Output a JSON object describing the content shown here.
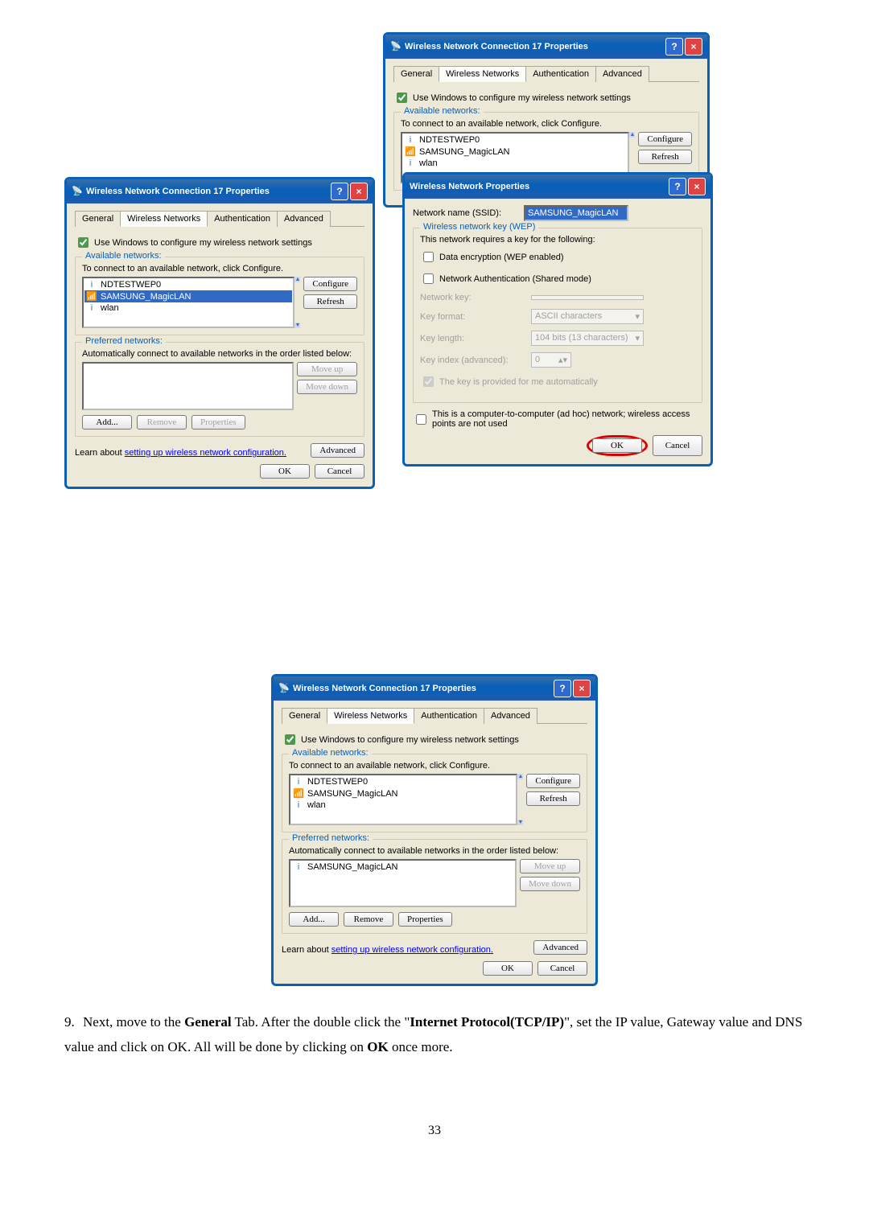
{
  "dialogs": {
    "left": {
      "title": "Wireless Network Connection 17 Properties",
      "tabs": [
        "General",
        "Wireless Networks",
        "Authentication",
        "Advanced"
      ],
      "use_windows": "Use Windows to configure my wireless network settings",
      "available_title": "Available networks:",
      "available_text": "To connect to an available network, click Configure.",
      "networks": [
        "NDTESTWEP0",
        "SAMSUNG_MagicLAN",
        "wlan"
      ],
      "configure": "Configure",
      "refresh": "Refresh",
      "preferred_title": "Preferred networks:",
      "preferred_text": "Automatically connect to available networks in the order listed below:",
      "move_up": "Move up",
      "move_down": "Move down",
      "add": "Add...",
      "remove": "Remove",
      "properties": "Properties",
      "learn_pre": "Learn about ",
      "learn_link": "setting up wireless network configuration.",
      "advanced": "Advanced",
      "ok": "OK",
      "cancel": "Cancel"
    },
    "right_top": {
      "title": "Wireless Network Connection 17 Properties",
      "tabs": [
        "General",
        "Wireless Networks",
        "Authentication",
        "Advanced"
      ],
      "use_windows": "Use Windows to configure my wireless network settings",
      "available_title": "Available networks:",
      "available_text": "To connect to an available network, click Configure.",
      "networks": [
        "NDTESTWEP0",
        "SAMSUNG_MagicLAN",
        "wlan"
      ],
      "configure": "Configure",
      "refresh": "Refresh"
    },
    "wnp": {
      "title": "Wireless Network Properties",
      "ssid_label": "Network name (SSID):",
      "ssid_value": "SAMSUNG_MagicLAN",
      "wep_title": "Wireless network key (WEP)",
      "wep_text": "This network requires a key for the following:",
      "data_enc": "Data encryption (WEP enabled)",
      "net_auth": "Network Authentication (Shared mode)",
      "net_key": "Network key:",
      "key_format": "Key format:",
      "key_format_val": "ASCII characters",
      "key_length": "Key length:",
      "key_length_val": "104 bits (13 characters)",
      "key_index": "Key index (advanced):",
      "key_index_val": "0",
      "key_auto": "The key is provided for me automatically",
      "adhoc": "This is a computer-to-computer (ad hoc) network; wireless access points are not used",
      "ok": "OK",
      "cancel": "Cancel"
    },
    "bottom": {
      "title": "Wireless Network Connection 17 Properties",
      "tabs": [
        "General",
        "Wireless Networks",
        "Authentication",
        "Advanced"
      ],
      "use_windows": "Use Windows to configure my wireless network settings",
      "available_title": "Available networks:",
      "available_text": "To connect to an available network, click Configure.",
      "networks": [
        "NDTESTWEP0",
        "SAMSUNG_MagicLAN",
        "wlan"
      ],
      "configure": "Configure",
      "refresh": "Refresh",
      "preferred_title": "Preferred networks:",
      "preferred_text": "Automatically connect to available networks in the order listed below:",
      "pref_item": "SAMSUNG_MagicLAN",
      "move_up": "Move up",
      "move_down": "Move down",
      "add": "Add...",
      "remove": "Remove",
      "properties": "Properties",
      "learn_pre": "Learn about ",
      "learn_link": "setting up wireless network configuration.",
      "advanced": "Advanced",
      "ok": "OK",
      "cancel": "Cancel"
    }
  },
  "instruction": {
    "num": "9.",
    "p1a": "Next, move to the ",
    "p1b": "General",
    "p1c": " Tab. After the double click the \"",
    "p1d": "Internet Protocol(TCP/IP)",
    "p1e": "\", set the IP value, Gateway value and DNS value and click on OK. All will be done by clicking  on ",
    "p1f": "OK",
    "p1g": " once more."
  },
  "page_number": "33"
}
